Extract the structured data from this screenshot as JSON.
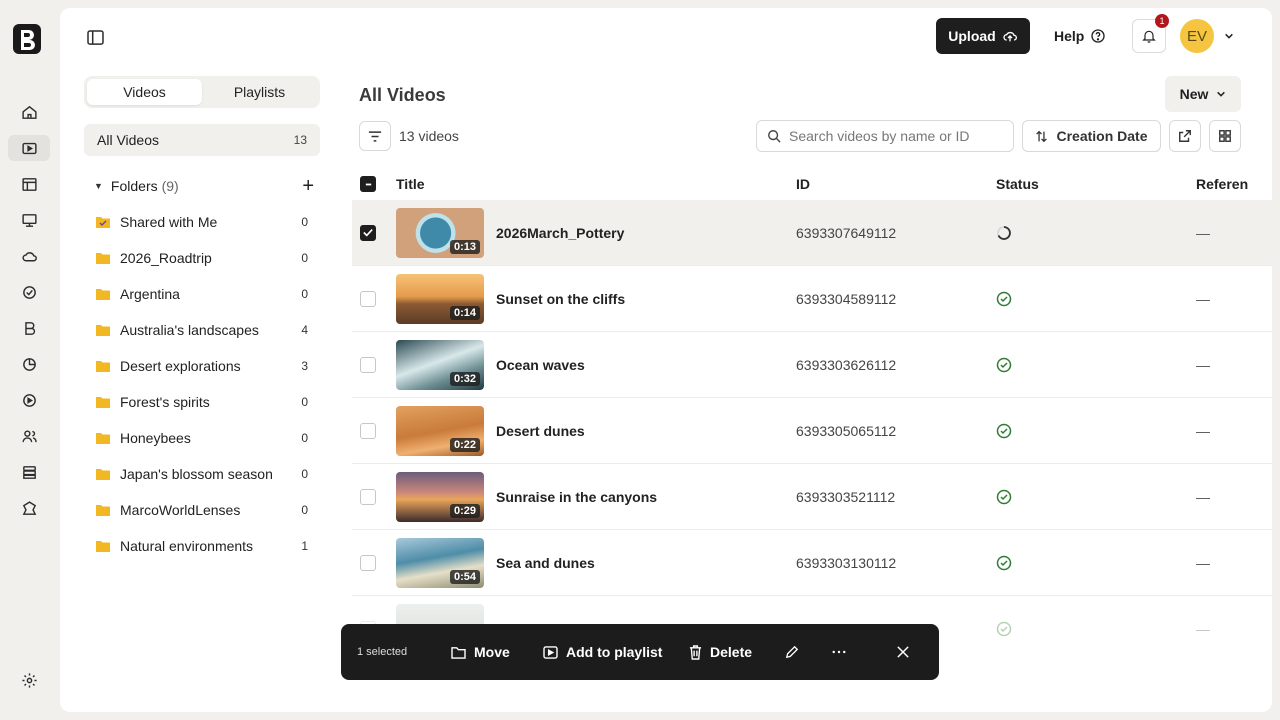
{
  "rail": {
    "icons": [
      "home-icon",
      "video-icon",
      "table-icon",
      "monitor-icon",
      "cloud-icon",
      "badge-icon",
      "brand-icon",
      "analytics-icon",
      "play-icon",
      "users-icon",
      "database-icon",
      "puzzle-icon"
    ],
    "settings": "settings-icon"
  },
  "sidebar": {
    "tabs": [
      {
        "label": "Videos",
        "active": true
      },
      {
        "label": "Playlists",
        "active": false
      }
    ],
    "all_videos": {
      "label": "All Videos",
      "count": "13"
    },
    "folders_label": "Folders",
    "folders_count": "(9)",
    "folders": [
      {
        "name": "Shared with Me",
        "count": "0",
        "shared": true
      },
      {
        "name": "2026_Roadtrip",
        "count": "0"
      },
      {
        "name": "Argentina",
        "count": "0"
      },
      {
        "name": "Australia's landscapes",
        "count": "4"
      },
      {
        "name": "Desert explorations",
        "count": "3"
      },
      {
        "name": "Forest's spirits",
        "count": "0"
      },
      {
        "name": "Honeybees",
        "count": "0"
      },
      {
        "name": "Japan's blossom season",
        "count": "0"
      },
      {
        "name": "MarcoWorldLenses",
        "count": "0"
      },
      {
        "name": "Natural environments",
        "count": "1"
      }
    ]
  },
  "header": {
    "upload": "Upload",
    "help": "Help",
    "notif_count": "1",
    "avatar": "EV"
  },
  "main": {
    "title": "All Videos",
    "new_label": "New",
    "video_count": "13 videos",
    "search_placeholder": "Search videos by name or ID",
    "sort_label": "Creation Date",
    "columns": {
      "title": "Title",
      "id": "ID",
      "status": "Status",
      "reference": "Referen"
    },
    "rows": [
      {
        "title": "2026March_Pottery",
        "id": "6393307649112",
        "duration": "0:13",
        "status": "processing",
        "ref": "—",
        "selected": true
      },
      {
        "title": "Sunset on the cliffs",
        "id": "6393304589112",
        "duration": "0:14",
        "status": "ready",
        "ref": "—",
        "selected": false
      },
      {
        "title": "Ocean waves",
        "id": "6393303626112",
        "duration": "0:32",
        "status": "ready",
        "ref": "—",
        "selected": false
      },
      {
        "title": "Desert dunes",
        "id": "6393305065112",
        "duration": "0:22",
        "status": "ready",
        "ref": "—",
        "selected": false
      },
      {
        "title": "Sunraise in the canyons",
        "id": "6393303521112",
        "duration": "0:29",
        "status": "ready",
        "ref": "—",
        "selected": false
      },
      {
        "title": "Sea and dunes",
        "id": "6393303130112",
        "duration": "0:54",
        "status": "ready",
        "ref": "—",
        "selected": false
      }
    ]
  },
  "action_bar": {
    "selected": "1 selected",
    "move": "Move",
    "add_to_playlist": "Add to playlist",
    "delete": "Delete"
  },
  "colors": {
    "accent": "#1e1e1e",
    "ready": "#2e7d32",
    "badge": "#b0171d",
    "avatar": "#f5c542"
  }
}
